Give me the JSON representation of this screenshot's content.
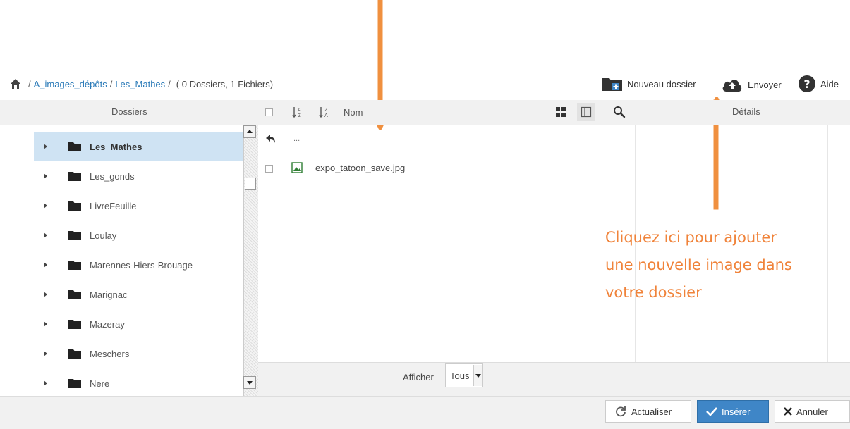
{
  "breadcrumb": {
    "sep": "/",
    "folder1": "A_images_dépôts",
    "folder2": "Les_Mathes",
    "summary": "( 0 Dossiers, 1 Fichiers)"
  },
  "toolbar": {
    "new_folder": "Nouveau dossier",
    "upload": "Envoyer",
    "help": "Aide"
  },
  "columns": {
    "dossiers": "Dossiers",
    "nom": "Nom",
    "details": "Détails"
  },
  "tree": {
    "items": [
      {
        "label": "Les_Mathes",
        "selected": true
      },
      {
        "label": "Les_gonds"
      },
      {
        "label": "LivreFeuille"
      },
      {
        "label": "Loulay"
      },
      {
        "label": "Marennes-Hiers-Brouage"
      },
      {
        "label": "Marignac"
      },
      {
        "label": "Mazeray"
      },
      {
        "label": "Meschers"
      },
      {
        "label": "Nere"
      }
    ]
  },
  "files": {
    "parent": "...",
    "items": [
      {
        "name": "expo_tatoon_save.jpg"
      }
    ]
  },
  "filter": {
    "label": "Afficher",
    "value": "Tous"
  },
  "actions": {
    "refresh": "Actualiser",
    "insert": "Insérer",
    "cancel": "Annuler"
  },
  "annotation": {
    "line1": "Cliquez ici pour ajouter",
    "line2": "une nouvelle image dans",
    "line3": "votre dossier"
  },
  "colors": {
    "accent": "#3f86c7",
    "annotation": "#f0833a",
    "selected_row": "#cfe3f3"
  }
}
